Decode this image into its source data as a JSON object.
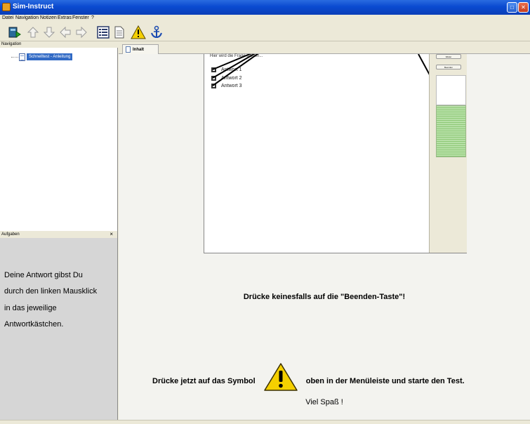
{
  "window": {
    "title": "Sim-Instruct",
    "icon": "app-icon",
    "controls": [
      "maximize-icon",
      "close-icon"
    ]
  },
  "menu": {
    "items": [
      "Datei",
      "Navigation",
      "Notizen",
      "Extras",
      "Fenster",
      "?"
    ]
  },
  "toolbar": {
    "buttons": [
      "book-exit-icon",
      "arrow-up-icon",
      "arrow-down-icon",
      "arrow-left-icon",
      "arrow-right-icon",
      "list-icon",
      "page-icon",
      "warning-icon",
      "anchor-icon"
    ]
  },
  "navigation": {
    "header": "Navigation",
    "tree_item": "Schnelltest - Anleitung",
    "selection_color": "#316ac5"
  },
  "aufgaben": {
    "header": "Aufgaben",
    "close": "×",
    "lines": [
      "Deine Antwort gibst Du",
      "durch den linken Mausklick",
      "in das jeweilige",
      "Antwortkästchen."
    ]
  },
  "tabs": {
    "content_tab": "Inhalt"
  },
  "preview": {
    "question": "Hier wird die Frage stehen...",
    "answers": [
      "Antwort 1",
      "Antwort 2",
      "Antwort 3"
    ],
    "side_buttons": [
      "Weiter",
      "Beenden"
    ]
  },
  "instructions": {
    "beenden": "Drücke keinesfalls auf die \"Beenden-Taste\"!",
    "symbol_before": "Drücke jetzt auf das Symbol",
    "symbol_after": "oben in der Menüleiste und starte den Test.",
    "fun": "Viel Spaß !"
  },
  "colors": {
    "titlebar": "#0a4ad0",
    "warning_yellow": "#f5d000",
    "progress_green": "#8fc978"
  }
}
